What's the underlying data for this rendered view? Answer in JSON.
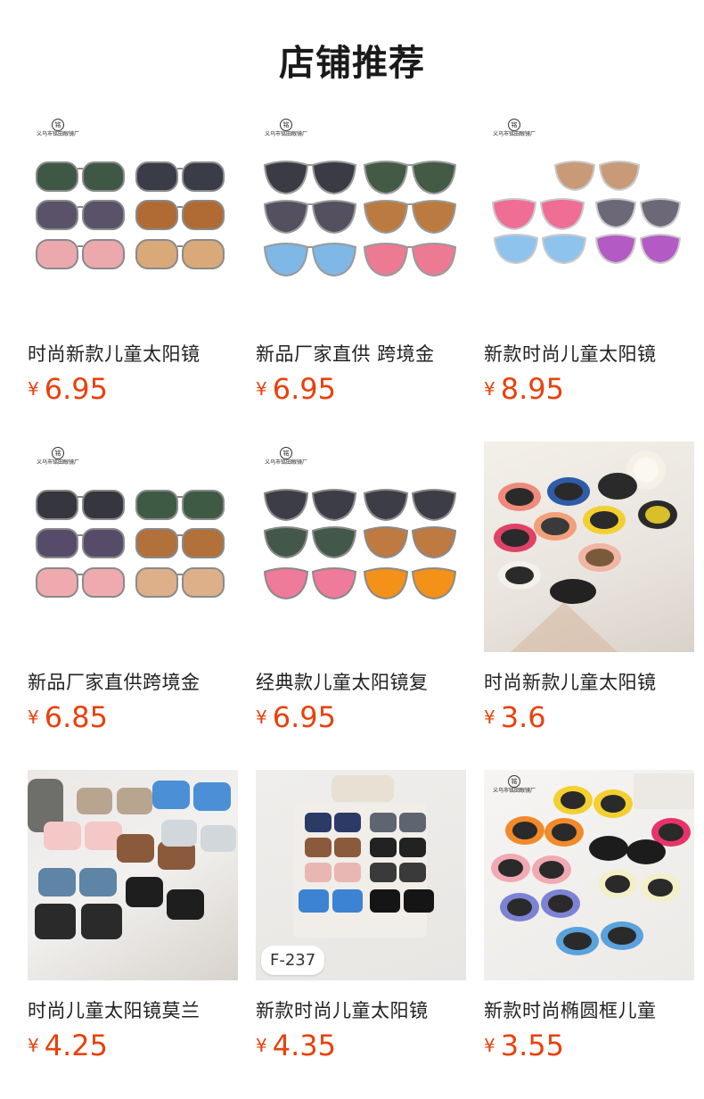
{
  "page": {
    "title": "店铺推荐"
  },
  "products": [
    {
      "name": "时尚新款儿童太阳镜",
      "currency": "¥",
      "price": "6.95",
      "photo_label": "",
      "logo": "义乌市铭田眼镜厂"
    },
    {
      "name": "新品厂家直供 跨境金",
      "currency": "¥",
      "price": "6.95",
      "photo_label": "",
      "logo": "义乌市铭田眼镜厂"
    },
    {
      "name": "新款时尚儿童太阳镜",
      "currency": "¥",
      "price": "8.95",
      "photo_label": "",
      "logo": "义乌市铭田眼镜厂"
    },
    {
      "name": "新品厂家直供跨境金",
      "currency": "¥",
      "price": "6.85",
      "photo_label": "",
      "logo": "义乌市铭田眼镜厂"
    },
    {
      "name": "经典款儿童太阳镜复",
      "currency": "¥",
      "price": "6.95",
      "photo_label": "",
      "logo": "义乌市铭田眼镜厂"
    },
    {
      "name": "时尚新款儿童太阳镜",
      "currency": "¥",
      "price": "3.6",
      "photo_label": "",
      "logo": ""
    },
    {
      "name": "时尚儿童太阳镜莫兰",
      "currency": "¥",
      "price": "4.25",
      "photo_label": "",
      "logo": ""
    },
    {
      "name": "新款时尚儿童太阳镜",
      "currency": "¥",
      "price": "4.35",
      "photo_label": "F-237",
      "logo": ""
    },
    {
      "name": "新款时尚椭圆框儿童",
      "currency": "¥",
      "price": "3.55",
      "photo_label": "",
      "logo": "义乌市铭田眼镜厂"
    }
  ]
}
